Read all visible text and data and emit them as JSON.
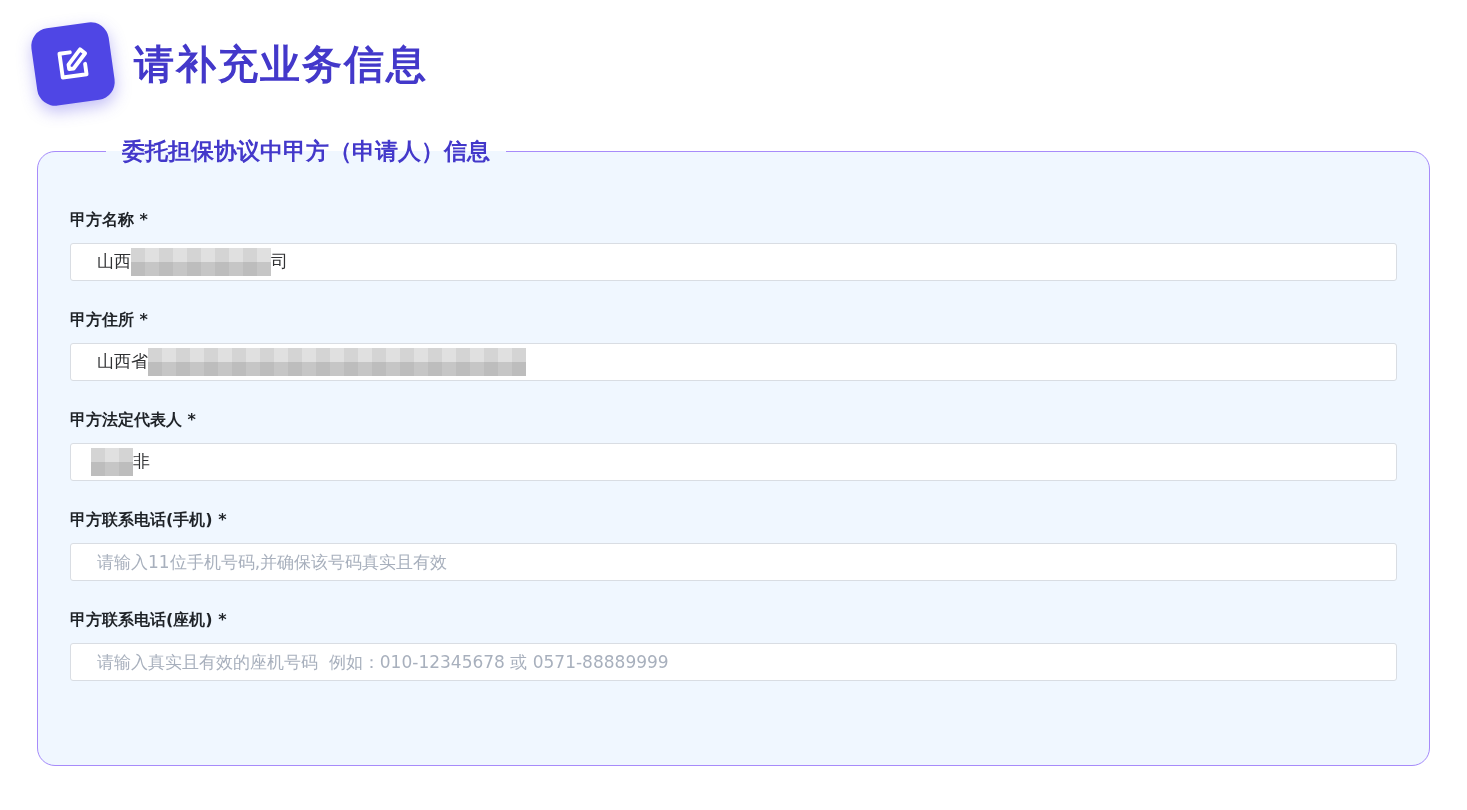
{
  "title": "请补充业务信息",
  "section": {
    "legend": "委托担保协议中甲方（申请人）信息",
    "fields": [
      {
        "label": "甲方名称 *",
        "value_parts": [
          {
            "kind": "text",
            "text": "山西"
          },
          {
            "kind": "redacted"
          },
          {
            "kind": "text",
            "text": "司"
          }
        ]
      },
      {
        "label": "甲方住所 *",
        "value_parts": [
          {
            "kind": "text",
            "text": "山西省"
          },
          {
            "kind": "redacted"
          }
        ]
      },
      {
        "label": "甲方法定代表人 *",
        "value_parts": [
          {
            "kind": "redacted"
          },
          {
            "kind": "text",
            "text": "非"
          }
        ]
      },
      {
        "label": "甲方联系电话(手机) *",
        "placeholder": "请输入11位手机号码,并确保该号码真实且有效"
      },
      {
        "label": "甲方联系电话(座机) *",
        "placeholder": "请输入真实且有效的座机号码  例如：010-12345678 或 0571-88889999"
      }
    ]
  }
}
